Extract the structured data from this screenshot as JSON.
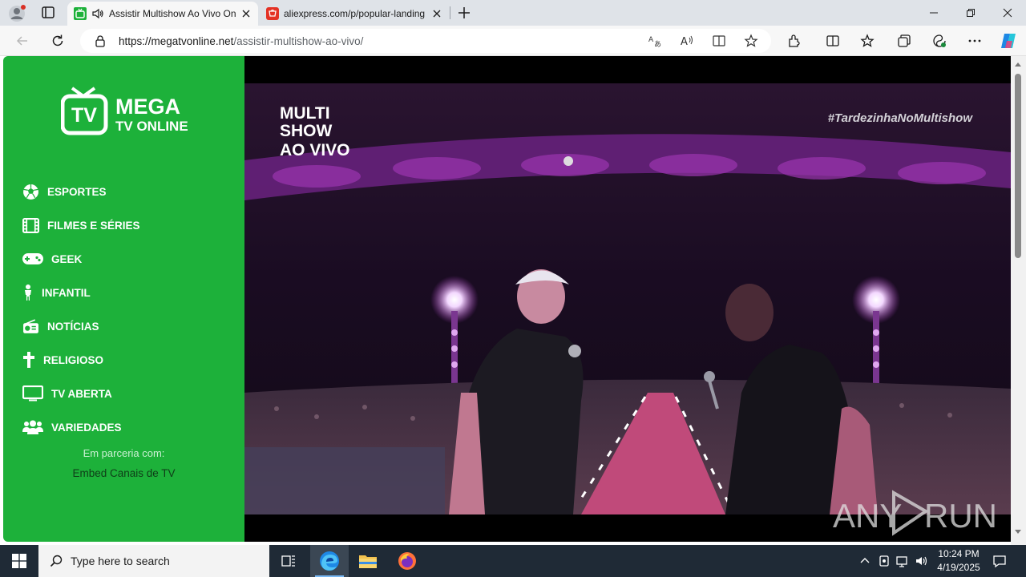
{
  "browser": {
    "tabs": [
      {
        "title": "Assistir Multishow Ao Vivo Online",
        "active": true
      },
      {
        "title": "aliexpress.com/p/popular-landing",
        "active": false
      }
    ],
    "url_domain": "https://megatvonline.net",
    "url_path": "/assistir-multishow-ao-vivo/"
  },
  "site": {
    "logo": {
      "badge": "TV",
      "line1": "MEGA",
      "line2": "TV ONLINE"
    },
    "menu": [
      {
        "label": "ESPORTES",
        "icon": "soccer-ball-icon"
      },
      {
        "label": "FILMES E SÉRIES",
        "icon": "film-icon"
      },
      {
        "label": "GEEK",
        "icon": "gamepad-icon"
      },
      {
        "label": "INFANTIL",
        "icon": "child-icon"
      },
      {
        "label": "NOTÍCIAS",
        "icon": "radio-icon"
      },
      {
        "label": "RELIGIOSO",
        "icon": "cross-icon"
      },
      {
        "label": "TV ABERTA",
        "icon": "monitor-icon"
      },
      {
        "label": "VARIEDADES",
        "icon": "users-icon"
      }
    ],
    "partner_label": "Em parceria com:",
    "partner_link": "Embed Canais de TV"
  },
  "video": {
    "channel_logo": [
      "MULTI",
      "SHOW",
      "AO VIVO"
    ],
    "hashtag": "#TardezinhaNoMultishow",
    "watermark_left": "ANY",
    "watermark_right": "RUN"
  },
  "taskbar": {
    "search_placeholder": "Type here to search",
    "time": "10:24 PM",
    "date": "4/19/2025"
  },
  "colors": {
    "sidebar": "#1db13a",
    "stage_purple": "#b03cc8",
    "taskbar": "#1f2a36"
  }
}
